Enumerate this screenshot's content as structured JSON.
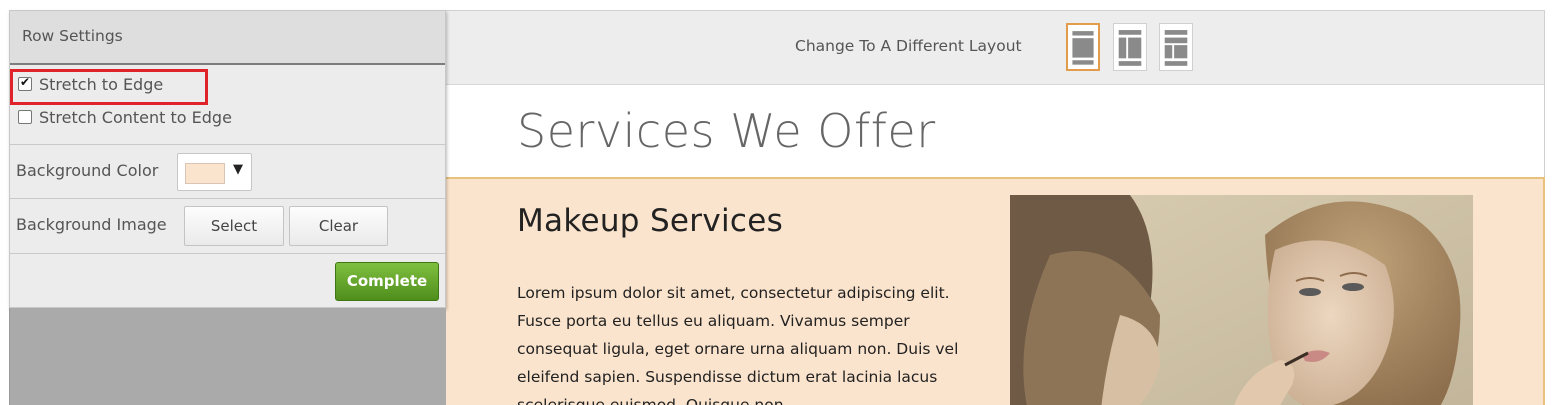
{
  "panel": {
    "title": "Row Settings",
    "stretch_to_edge": {
      "label": "Stretch to Edge",
      "checked": true
    },
    "stretch_content": {
      "label": "Stretch Content to Edge",
      "checked": false
    },
    "background_color": {
      "label": "Background Color",
      "value": "#fbe4cd"
    },
    "background_image": {
      "label": "Background Image",
      "select_label": "Select",
      "clear_label": "Clear"
    },
    "complete_label": "Complete"
  },
  "layout_bar": {
    "label": "Change To A Different Layout",
    "options": [
      "full-width-layout-icon",
      "columns-layout-icon",
      "sidebar-layout-icon"
    ],
    "active_index": 0
  },
  "page": {
    "heading": "Services We Offer",
    "row": {
      "title": "Makeup Services",
      "body": "Lorem ipsum dolor sit amet, consectetur adipiscing elit. Fusce porta eu tellus eu aliquam. Vivamus semper consequat ligula, eget ornare urna aliquam non. Duis vel eleifend sapien. Suspendisse dictum erat lacinia lacus scelerisque euismod. Quisque non"
    }
  },
  "colors": {
    "highlight": "#e0232b",
    "complete_green": "#5fa328",
    "row_background": "#fbe4cd",
    "row_border": "#e8c27a",
    "active_layout": "#e39b4c"
  }
}
